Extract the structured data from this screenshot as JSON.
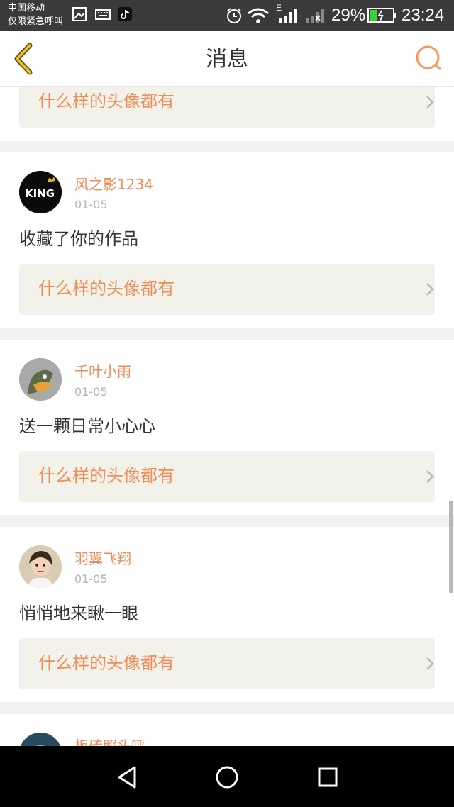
{
  "status_bar": {
    "carrier_line1": "中国移动",
    "carrier_line2": "仅限紧急呼叫",
    "network_label": "E",
    "battery_percent": "29%",
    "time": "23:24"
  },
  "header": {
    "title": "消息"
  },
  "feed": {
    "partial_top_topic": "什么样的头像都有",
    "items": [
      {
        "username": "风之影1234",
        "date": "01-05",
        "message": "收藏了你的作品",
        "topic": "什么样的头像都有",
        "avatar_text": "KING"
      },
      {
        "username": "千叶小雨",
        "date": "01-05",
        "message": "送一颗日常小心心",
        "topic": "什么样的头像都有"
      },
      {
        "username": "羽翼飞翔",
        "date": "01-05",
        "message": "悄悄地来瞅一眼",
        "topic": "什么样的头像都有"
      }
    ],
    "partial_bottom_username": "板砖照头呼"
  },
  "colors": {
    "accent": "#ef8d59",
    "topic_bg": "#f3f2ea",
    "page_bg": "#f2f2f2",
    "status_bar_bg": "#3a3a3a"
  },
  "icons": {
    "back": "chevron-left-icon",
    "search": "search-icon",
    "topic_arrow": "chevron-right-icon",
    "nav_back": "triangle-back-icon",
    "nav_home": "circle-home-icon",
    "nav_recent": "square-recent-icon"
  }
}
